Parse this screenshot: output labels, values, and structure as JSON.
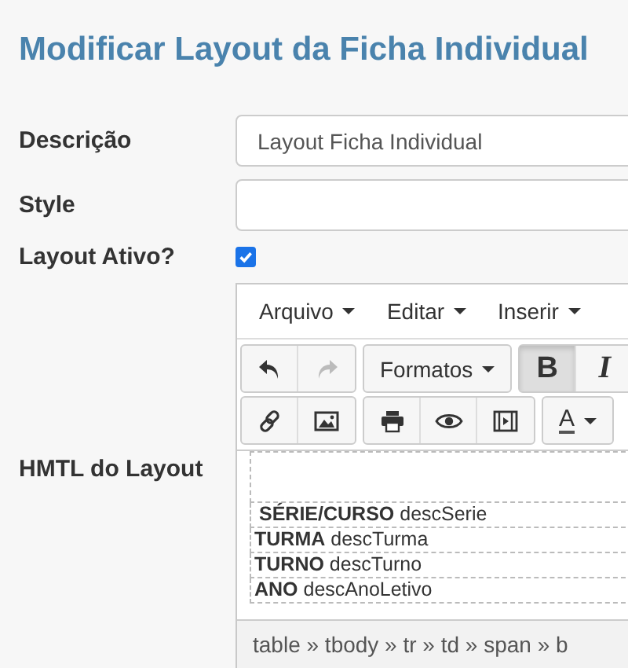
{
  "title": "Modificar Layout da Ficha Individual",
  "fields": [
    {
      "label": "Descrição",
      "kind": "text",
      "value": "Layout Ficha Individual"
    },
    {
      "label": "Style",
      "kind": "text"
    },
    {
      "label": "Layout Ativo?",
      "kind": "checkbox",
      "checked": true
    }
  ],
  "editor": {
    "label": "HMTL do Layout",
    "menu": [
      "Arquivo",
      "Editar",
      "Inserir"
    ],
    "toolbar": [
      [
        [
          {
            "kind": "undo",
            "disabled": false
          },
          {
            "kind": "redo",
            "disabled": true
          }
        ],
        [
          {
            "kind": "dropdown",
            "label": "Formatos"
          }
        ],
        [
          {
            "kind": "text",
            "label": "B",
            "selected": true
          },
          {
            "kind": "text",
            "label": "I",
            "selected": false
          }
        ]
      ],
      [
        [
          {
            "kind": "link",
            "disabled": false
          },
          {
            "kind": "image",
            "disabled": false
          }
        ],
        [
          {
            "kind": "print",
            "disabled": false
          },
          {
            "kind": "preview",
            "disabled": false
          },
          {
            "kind": "media",
            "disabled": false
          }
        ],
        [
          {
            "kind": "color",
            "label": "A"
          }
        ]
      ]
    ],
    "rows": [
      {
        "label": "SÉRIE/CURSO",
        "value": "descSerie"
      },
      {
        "label": "TURMA",
        "value": "descTurma"
      },
      {
        "label": "TURNO",
        "value": "descTurno"
      },
      {
        "label": "ANO",
        "value": "descAnoLetivo"
      }
    ],
    "status": "table » tbody » tr » td » span » b"
  }
}
